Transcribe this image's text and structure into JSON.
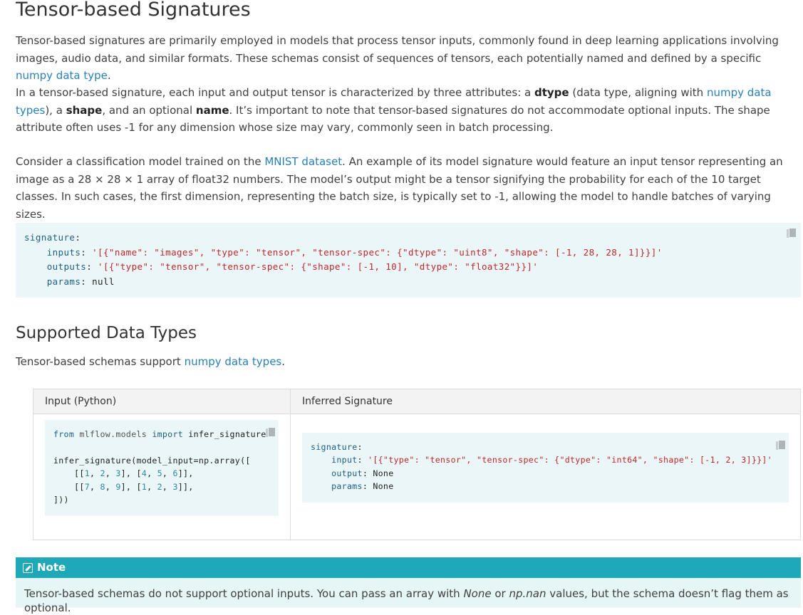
{
  "heading1": "Tensor-based Signatures",
  "p1": {
    "text": "Tensor-based signatures are primarily employed in models that process tensor inputs, commonly found in deep learning applications involving images, audio data, and similar formats. These schemas consist of sequences of tensors, each potentially named and defined by a specific ",
    "link": "numpy data type",
    "end": "."
  },
  "p2": {
    "t1": "In a tensor-based signature, each input and output tensor is characterized by three attributes: a ",
    "b1": "dtype",
    "t2": " (data type, aligning with ",
    "link": "numpy data types",
    "t3": "), a ",
    "b2": "shape",
    "t4": ", and an optional ",
    "b3": "name",
    "t5": ". It’s important to note that tensor-based signatures do not accommodate optional inputs. The shape attribute often uses -1 for any dimension whose size may vary, commonly seen in batch processing."
  },
  "p3": {
    "t1": "Consider a classification model trained on the ",
    "link": "MNIST dataset",
    "t2": ". An example of its model signature would feature an input tensor representing an image as a 28 × 28 × 1 array of float32 numbers. The model’s output might be a tensor signifying the probability for each of the 10 target classes. In such cases, the first dimension, representing the batch size, is typically set to -1, allowing the model to handle batches of varying sizes."
  },
  "code1": {
    "l1_key": "signature",
    "l2_key": "inputs",
    "l2_val": "'[{\"name\": \"images\", \"type\": \"tensor\", \"tensor-spec\": {\"dtype\": \"uint8\", \"shape\": [-1, 28, 28, 1]}}]'",
    "l3_key": "outputs",
    "l3_val": "'[{\"type\": \"tensor\", \"tensor-spec\": {\"shape\": [-1, 10], \"dtype\": \"float32\"}}]'",
    "l4_key": "params",
    "l4_val": "null"
  },
  "heading2": "Supported Data Types",
  "p4": {
    "text": "Tensor-based schemas support ",
    "link": "numpy data types",
    "end": "."
  },
  "table": {
    "col1": "Input (Python)",
    "col2": "Inferred Signature",
    "py": {
      "from": "from",
      "module": "mlflow.models",
      "import": "import",
      "func": "infer_signature",
      "l3": "infer_signature(model_input=np.array([",
      "l4_a": "[[",
      "l4_nums": [
        "1",
        "2",
        "3",
        "4",
        "5",
        "6"
      ],
      "l5_nums": [
        "7",
        "8",
        "9",
        "1",
        "2",
        "3"
      ],
      "l6": "]))"
    },
    "sig": {
      "l1_key": "signature",
      "l2_key": "input",
      "l2_val": "'[{\"type\": \"tensor\", \"tensor-spec\": {\"dtype\": \"int64\", \"shape\": [-1, 2, 3]}}]'",
      "l3_key": "output",
      "l3_val": "None",
      "l4_key": "params",
      "l4_val": "None"
    }
  },
  "note": {
    "title": "Note",
    "t1": "Tensor-based schemas do not support optional inputs. You can pass an array with ",
    "i1": "None",
    "t2": " or ",
    "i2": "np.nan",
    "t3": " values, but the schema doesn’t flag them as optional."
  },
  "colors": {
    "link": "#2980b9",
    "code_bg": "#eaf6f7",
    "note_header": "#1fa8b7",
    "note_bg": "#e6f5f6",
    "string": "#c0282a",
    "number": "#2a8c97",
    "key": "#1f5f85"
  }
}
